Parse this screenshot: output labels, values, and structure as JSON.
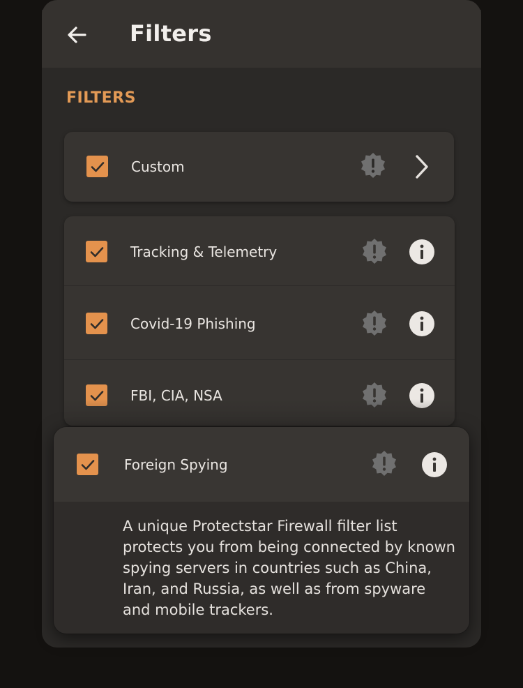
{
  "header": {
    "title": "Filters",
    "back_icon": "arrow-left-icon"
  },
  "section": {
    "heading": "FILTERS"
  },
  "custom": {
    "label": "Custom",
    "checked": true
  },
  "filters": [
    {
      "label": "Tracking & Telemetry",
      "checked": true
    },
    {
      "label": "Covid-19 Phishing",
      "checked": true
    },
    {
      "label": "FBI, CIA, NSA",
      "checked": true
    }
  ],
  "expanded": {
    "label": "Foreign Spying",
    "checked": true,
    "description": "A unique Protectstar Firewall filter list protects you from being connected by known spying servers in countries such as China, Iran, and Russia, as well as from spyware and mobile trackers."
  },
  "colors": {
    "accent": "#e4924d",
    "background": "#2b2927",
    "card": "#373431"
  }
}
